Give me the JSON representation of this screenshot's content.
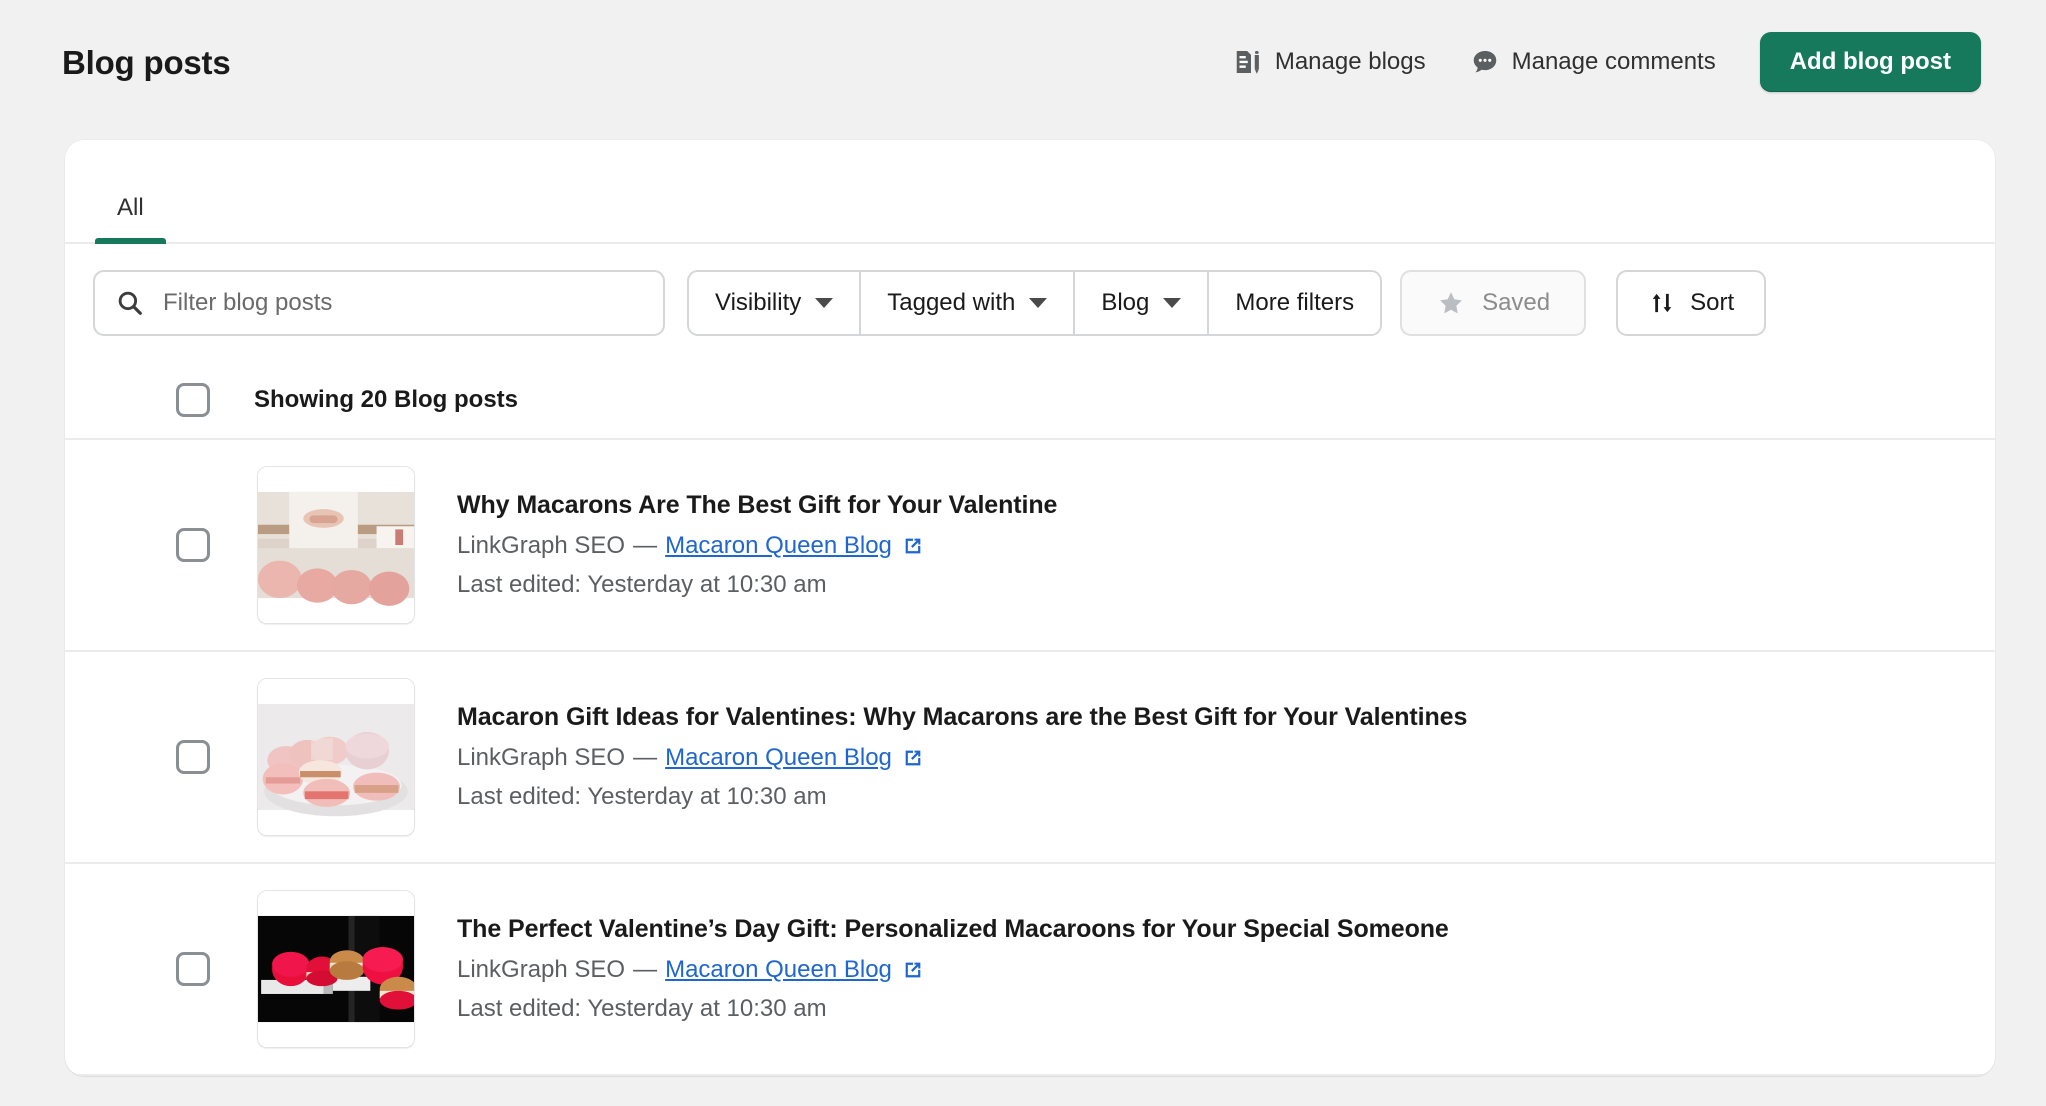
{
  "header": {
    "title": "Blog posts",
    "manage_blogs_label": "Manage blogs",
    "manage_comments_label": "Manage comments",
    "add_blog_post_label": "Add blog post"
  },
  "colors": {
    "accent_green": "#16795b",
    "link_blue": "#1f66d0",
    "page_background": "#f1f1f1",
    "card_background": "#ffffff",
    "border": "#d4d6d8",
    "muted_text": "#5c5f62"
  },
  "tabs": [
    {
      "label": "All",
      "active": true
    }
  ],
  "filters": {
    "search_placeholder": "Filter blog posts",
    "search_value": "",
    "buttons": [
      {
        "label": "Visibility",
        "has_caret": true
      },
      {
        "label": "Tagged with",
        "has_caret": true
      },
      {
        "label": "Blog",
        "has_caret": true
      },
      {
        "label": "More filters",
        "has_caret": false
      }
    ],
    "saved_label": "Saved",
    "sort_label": "Sort"
  },
  "list": {
    "select_all_label": "Showing 20 Blog posts",
    "rows": [
      {
        "title": "Why Macarons Are The Best Gift for Your Valentine",
        "author": "LinkGraph SEO",
        "separator": "—",
        "blog_link": "Macaron Queen Blog",
        "last_edited": "Last edited: Yesterday at 10:30 am",
        "thumbnail": "baker-shaping-pink-macarons"
      },
      {
        "title": "Macaron Gift Ideas for Valentines: Why Macarons are the Best Gift for Your Valentines",
        "author": "LinkGraph SEO",
        "separator": "—",
        "blog_link": "Macaron Queen Blog",
        "last_edited": "Last edited: Yesterday at 10:30 am",
        "thumbnail": "plate-of-pink-macarons"
      },
      {
        "title": "The Perfect Valentine’s Day Gift: Personalized Macaroons for Your Special Someone",
        "author": "LinkGraph SEO",
        "separator": "—",
        "blog_link": "Macaron Queen Blog",
        "last_edited": "Last edited: Yesterday at 10:30 am",
        "thumbnail": "red-macarons-on-black"
      }
    ]
  }
}
